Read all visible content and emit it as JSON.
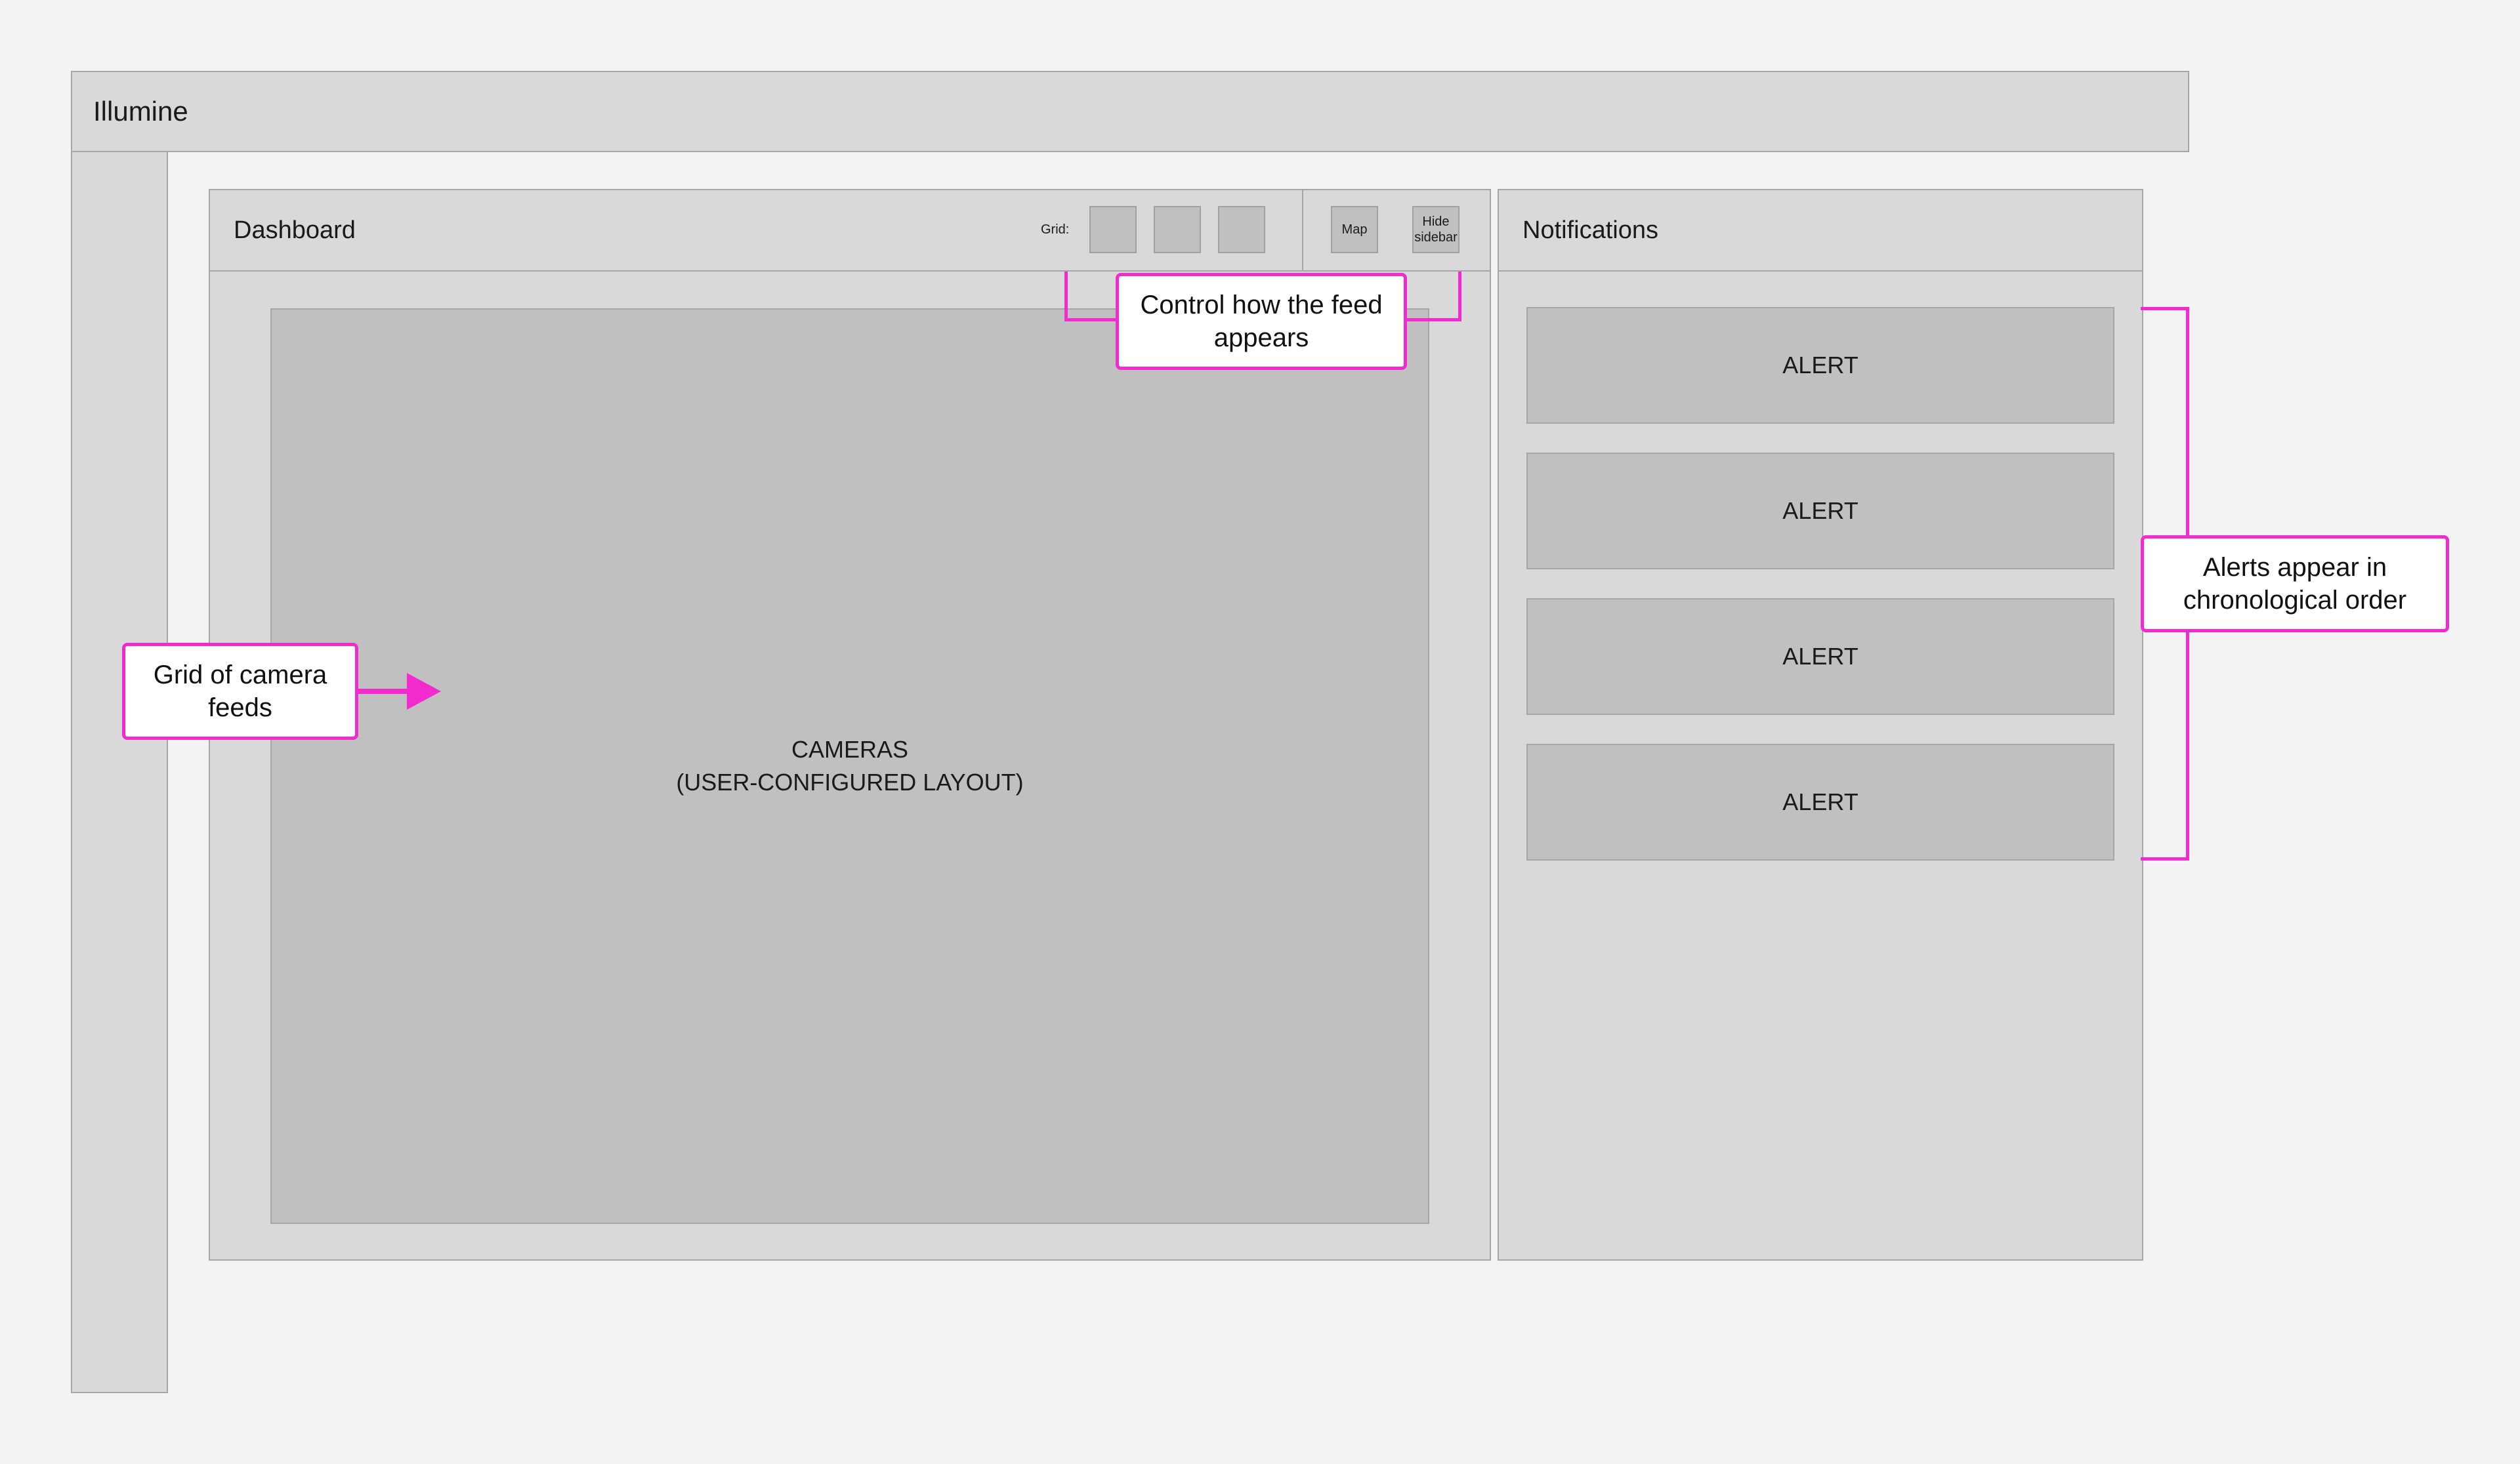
{
  "app": {
    "title": "Illumine"
  },
  "dashboard": {
    "title": "Dashboard",
    "grid_label": "Grid:",
    "map_label": "Map",
    "hide_sidebar_label": "Hide sidebar",
    "cameras_line1": "CAMERAS",
    "cameras_line2": "(USER-CONFIGURED LAYOUT)"
  },
  "notifications": {
    "title": "Notifications",
    "alerts": [
      "ALERT",
      "ALERT",
      "ALERT",
      "ALERT"
    ]
  },
  "annotations": {
    "control_feed": "Control how the feed appears",
    "camera_grid": "Grid of camera feeds",
    "alerts_order": "Alerts appear in chronological order"
  },
  "colors": {
    "annotation_accent": "#f22bcf",
    "panel_fill": "#d9d9d9",
    "placeholder_fill": "#c0c0c0"
  }
}
